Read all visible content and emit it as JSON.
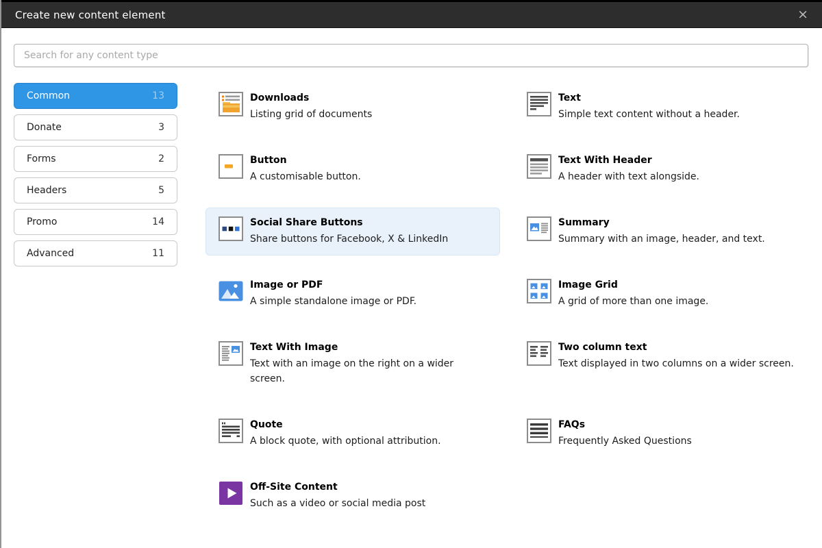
{
  "modal": {
    "title": "Create new content element",
    "close_icon": "×"
  },
  "search": {
    "placeholder": "Search for any content type"
  },
  "sidebar": {
    "items": [
      {
        "label": "Common",
        "count": "13",
        "selected": true
      },
      {
        "label": "Donate",
        "count": "3",
        "selected": false
      },
      {
        "label": "Forms",
        "count": "2",
        "selected": false
      },
      {
        "label": "Headers",
        "count": "5",
        "selected": false
      },
      {
        "label": "Promo",
        "count": "14",
        "selected": false
      },
      {
        "label": "Advanced",
        "count": "11",
        "selected": false
      }
    ]
  },
  "content": {
    "items": [
      {
        "title": "Downloads",
        "description": "Listing grid of documents",
        "icon": "downloads-icon",
        "highlighted": false
      },
      {
        "title": "Text",
        "description": "Simple text content without a header.",
        "icon": "text-icon",
        "highlighted": false
      },
      {
        "title": "Button",
        "description": "A customisable button.",
        "icon": "button-icon",
        "highlighted": false
      },
      {
        "title": "Text With Header",
        "description": "A header with text alongside.",
        "icon": "text-with-header-icon",
        "highlighted": false
      },
      {
        "title": "Social Share Buttons",
        "description": "Share buttons for Facebook, X & LinkedIn",
        "icon": "social-share-icon",
        "highlighted": true
      },
      {
        "title": "Summary",
        "description": "Summary with an image, header, and text.",
        "icon": "summary-icon",
        "highlighted": false
      },
      {
        "title": "Image or PDF",
        "description": "A simple standalone image or PDF.",
        "icon": "image-or-pdf-icon",
        "highlighted": false
      },
      {
        "title": "Image Grid",
        "description": "A grid of more than one image.",
        "icon": "image-grid-icon",
        "highlighted": false
      },
      {
        "title": "Text With Image",
        "description": "Text with an image on the right on a wider screen.",
        "icon": "text-with-image-icon",
        "highlighted": false
      },
      {
        "title": "Two column text",
        "description": "Text displayed in two columns on a wider screen.",
        "icon": "two-column-text-icon",
        "highlighted": false
      },
      {
        "title": "Quote",
        "description": "A block quote, with optional attribution.",
        "icon": "quote-icon",
        "highlighted": false
      },
      {
        "title": "FAQs",
        "description": "Frequently Asked Questions",
        "icon": "faqs-icon",
        "highlighted": false
      },
      {
        "title": "Off-Site Content",
        "description": "Such as a video or social media post",
        "icon": "off-site-content-icon",
        "highlighted": false
      }
    ]
  },
  "colors": {
    "header_bg": "#2d2d2d",
    "selected_category_bg": "#2f96e5",
    "highlighted_item_bg": "#e9f2fb",
    "icon_image_blue": "#4a90e2",
    "icon_orange": "#f0a32e",
    "icon_purple": "#7b35a3",
    "icon_facebook_blue": "#2c4a80",
    "icon_x_black": "#111111",
    "icon_linkedin_blue": "#2e75d4"
  }
}
